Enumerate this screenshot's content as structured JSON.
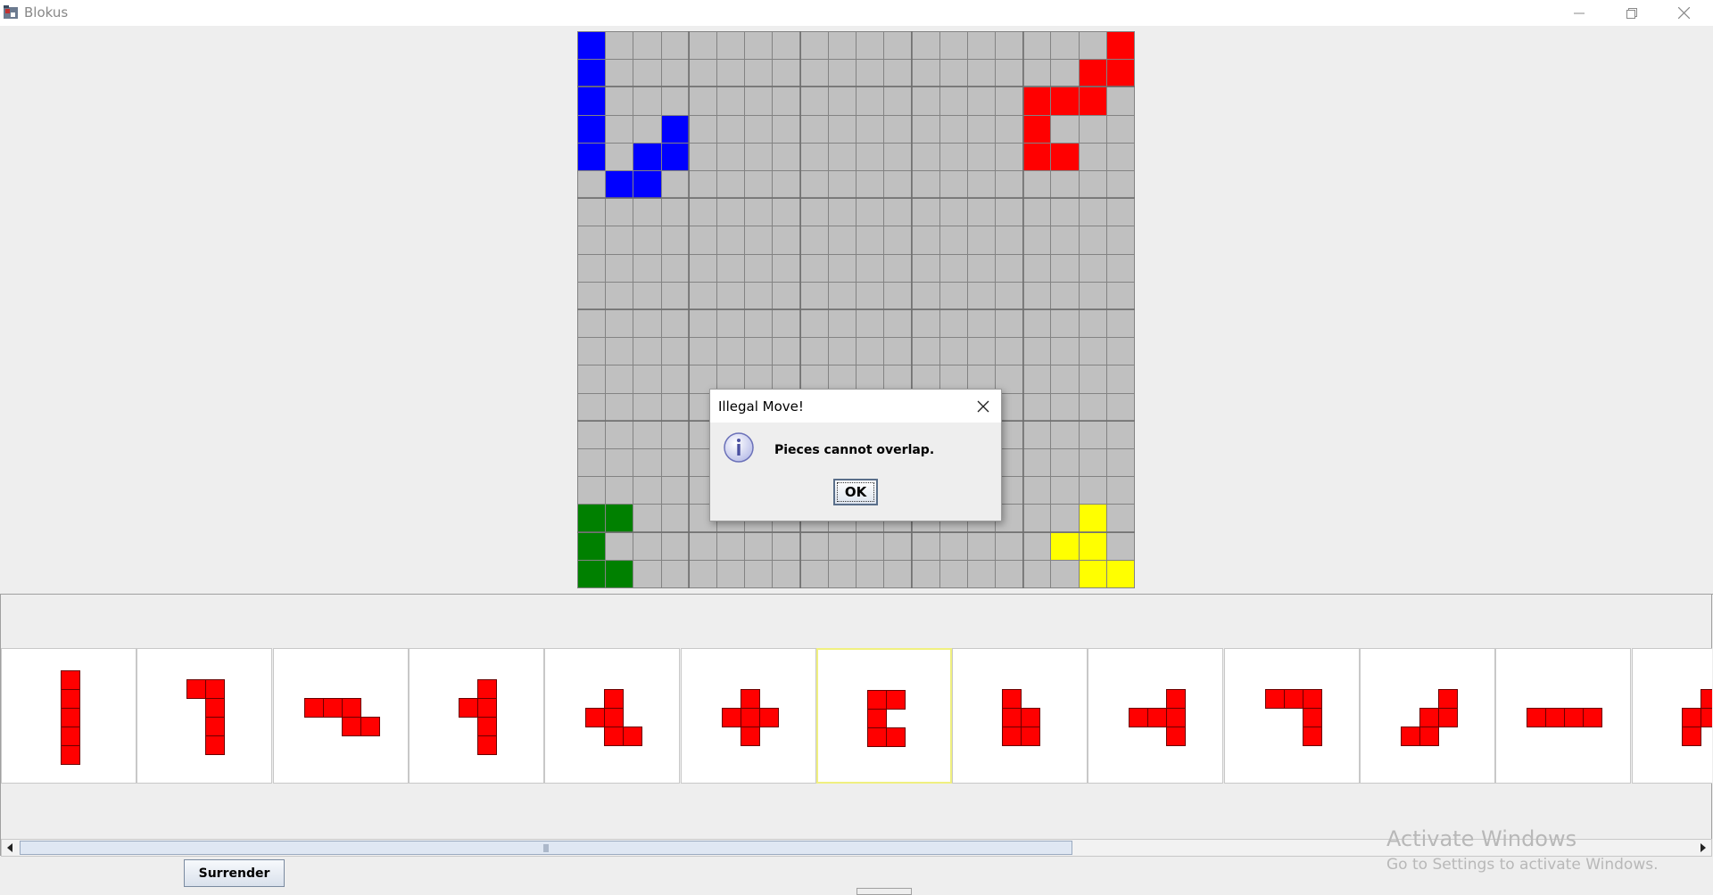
{
  "window": {
    "title": "Blokus",
    "controls": [
      "minimize-icon",
      "restore-icon",
      "close-icon"
    ]
  },
  "colors": {
    "blue": "#0000ff",
    "red": "#ff0000",
    "green": "#008000",
    "yellow": "#ffff00",
    "empty": "#c0c0c0",
    "selected_border": "#f0f080"
  },
  "board": {
    "size": 20,
    "cells": [
      {
        "color": "blue",
        "cells": [
          [
            0,
            0
          ],
          [
            0,
            1
          ],
          [
            0,
            2
          ],
          [
            0,
            3
          ],
          [
            0,
            4
          ],
          [
            1,
            5
          ],
          [
            2,
            5
          ],
          [
            2,
            4
          ],
          [
            3,
            4
          ],
          [
            3,
            3
          ]
        ]
      },
      {
        "color": "red",
        "cells": [
          [
            19,
            0
          ],
          [
            18,
            1
          ],
          [
            19,
            1
          ],
          [
            16,
            2
          ],
          [
            17,
            2
          ],
          [
            18,
            2
          ],
          [
            16,
            3
          ],
          [
            16,
            4
          ],
          [
            17,
            4
          ]
        ]
      },
      {
        "color": "green",
        "cells": [
          [
            0,
            17
          ],
          [
            1,
            17
          ],
          [
            0,
            18
          ],
          [
            0,
            19
          ],
          [
            1,
            19
          ]
        ]
      },
      {
        "color": "yellow",
        "cells": [
          [
            18,
            17
          ],
          [
            17,
            18
          ],
          [
            18,
            18
          ],
          [
            18,
            19
          ],
          [
            19,
            19
          ]
        ]
      }
    ]
  },
  "dialog": {
    "title": "Illegal Move!",
    "message": "Pieces cannot overlap.",
    "ok_label": "OK",
    "icon": "info-icon"
  },
  "pieces": {
    "color": "red",
    "selected_index": 6,
    "items": [
      [
        [
          0,
          0
        ],
        [
          0,
          1
        ],
        [
          0,
          2
        ],
        [
          0,
          3
        ],
        [
          0,
          4
        ]
      ],
      [
        [
          0,
          0
        ],
        [
          1,
          0
        ],
        [
          1,
          1
        ],
        [
          1,
          2
        ],
        [
          1,
          3
        ]
      ],
      [
        [
          0,
          0
        ],
        [
          1,
          0
        ],
        [
          2,
          0
        ],
        [
          2,
          1
        ],
        [
          3,
          1
        ]
      ],
      [
        [
          1,
          0
        ],
        [
          0,
          1
        ],
        [
          1,
          1
        ],
        [
          1,
          2
        ],
        [
          1,
          3
        ]
      ],
      [
        [
          1,
          0
        ],
        [
          0,
          1
        ],
        [
          1,
          1
        ],
        [
          1,
          2
        ],
        [
          2,
          2
        ]
      ],
      [
        [
          1,
          0
        ],
        [
          0,
          1
        ],
        [
          1,
          1
        ],
        [
          2,
          1
        ],
        [
          1,
          2
        ]
      ],
      [
        [
          0,
          0
        ],
        [
          1,
          0
        ],
        [
          0,
          1
        ],
        [
          0,
          2
        ],
        [
          1,
          2
        ]
      ],
      [
        [
          0,
          0
        ],
        [
          0,
          1
        ],
        [
          1,
          1
        ],
        [
          0,
          2
        ],
        [
          1,
          2
        ]
      ],
      [
        [
          2,
          0
        ],
        [
          0,
          1
        ],
        [
          1,
          1
        ],
        [
          2,
          1
        ],
        [
          2,
          2
        ]
      ],
      [
        [
          0,
          0
        ],
        [
          1,
          0
        ],
        [
          2,
          0
        ],
        [
          2,
          1
        ],
        [
          2,
          2
        ]
      ],
      [
        [
          2,
          0
        ],
        [
          1,
          1
        ],
        [
          2,
          1
        ],
        [
          0,
          2
        ],
        [
          1,
          2
        ]
      ],
      [
        [
          0,
          0
        ],
        [
          1,
          0
        ],
        [
          2,
          0
        ],
        [
          3,
          0
        ]
      ],
      [
        [
          1,
          0
        ],
        [
          0,
          1
        ],
        [
          1,
          1
        ],
        [
          0,
          2
        ]
      ]
    ]
  },
  "controls": {
    "surrender_label": "Surrender"
  },
  "watermark": {
    "line1": "Activate Windows",
    "line2": "Go to Settings to activate Windows."
  }
}
